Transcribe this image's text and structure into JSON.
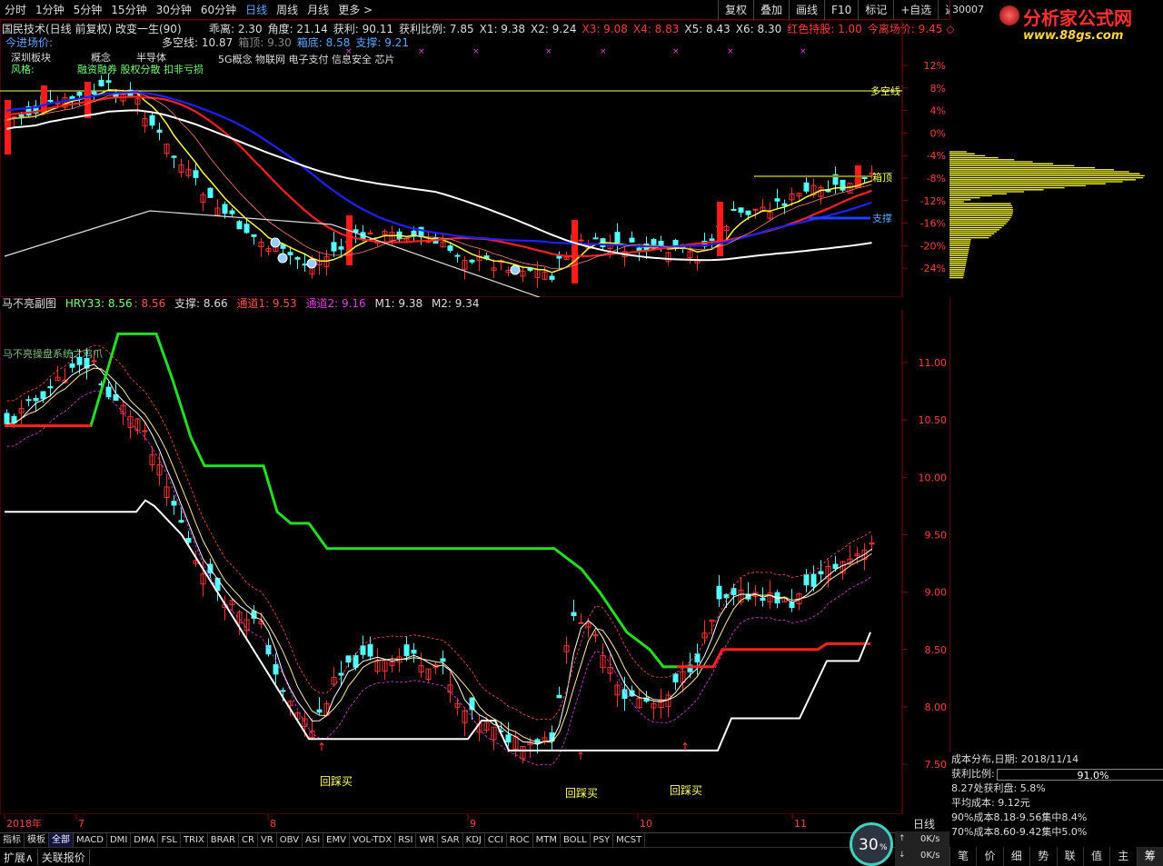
{
  "toolbar": {
    "periods": [
      "分时",
      "1分钟",
      "5分钟",
      "15分钟",
      "30分钟",
      "60分钟",
      "日线",
      "周线",
      "月线",
      "更多 >"
    ],
    "active": "日线",
    "right": [
      "复权",
      "叠加",
      "画线",
      "F10",
      "标记",
      "+自选",
      "返回"
    ]
  },
  "stock_code": "30007",
  "logo": {
    "title": "分析家公式网",
    "url": "www.88gs.com"
  },
  "main_panel": {
    "title": "国民技术(日线 前复权) 改变一生(90)",
    "line1": [
      {
        "t": "乖离: 2.30",
        "c": "#ddd"
      },
      {
        "t": "角度: 21.14",
        "c": "#ddd"
      },
      {
        "t": "获利: 90.11",
        "c": "#ddd"
      },
      {
        "t": "获利比例: 7.85",
        "c": "#ddd"
      },
      {
        "t": "X1: 9.38",
        "c": "#ddd"
      },
      {
        "t": "X2: 9.24",
        "c": "#ddd"
      },
      {
        "t": "X3: 9.08",
        "c": "#ff3a3a"
      },
      {
        "t": "X4: 8.83",
        "c": "#ff3a3a"
      },
      {
        "t": "X5: 8.43",
        "c": "#ddd"
      },
      {
        "t": "X6: 8.30",
        "c": "#ddd"
      },
      {
        "t": "红色持股: 1.00",
        "c": "#ff3a3a"
      },
      {
        "t": "今离场价: 9.45 ◇",
        "c": "#ff3a3a"
      }
    ],
    "line2_left": "今进场价:",
    "line2": [
      {
        "t": "多空线: 10.87",
        "c": "#ddd"
      },
      {
        "t": "箱顶: 9.30",
        "c": "#888"
      },
      {
        "t": "箱底: 8.58",
        "c": "#5ea8ff"
      },
      {
        "t": "支撑: 9.21",
        "c": "#5ea8ff"
      }
    ],
    "board": "深圳板块",
    "concept": "概念",
    "style": "风格:",
    "style_tags": "融资融券 股权分散 扣非亏损",
    "semi": "半导体",
    "concept_list": "5G概念 物联网 电子支付 信息安全 芯片",
    "duokong_label": "多空线",
    "box_top_label": "箱顶",
    "support_label": "支撑",
    "pct_axis": [
      "12%",
      "8%",
      "4%",
      "0%",
      "-4%",
      "-8%",
      "-12%",
      "-16%",
      "-20%",
      "-24%"
    ]
  },
  "sub_panel": {
    "title": "马不亮副图",
    "hry": "HRY33: 8.56",
    "hry2": ": 8.56",
    "support": "支撑: 8.66",
    "ch1": "通道1: 9.53",
    "ch2": "通道2: 9.16",
    "m1": "M1: 9.38",
    "m2": "M2: 9.34",
    "note": "马不亮操盘系统之鸡爪",
    "price_axis": [
      "11.00",
      "10.50",
      "10.00",
      "9.50",
      "9.00",
      "8.50",
      "8.00",
      "7.50"
    ],
    "buy_labels": [
      "回踩买",
      "回踩买",
      "回踩买"
    ]
  },
  "time_axis": {
    "labels": [
      "2018年",
      "7",
      "8",
      "9",
      "10",
      "11"
    ],
    "period": "日线"
  },
  "indicator_tabs": [
    "指标",
    "模板",
    "全部",
    "MACD",
    "DMI",
    "DMA",
    "FSL",
    "TRIX",
    "BRAR",
    "CR",
    "VR",
    "OBV",
    "ASI",
    "EMV",
    "VOL-TDX",
    "RSI",
    "WR",
    "SAR",
    "KDJ",
    "CCI",
    "ROC",
    "MTM",
    "BOLL",
    "PSY",
    "MCST"
  ],
  "indicator_selected": "全部",
  "footer": [
    "扩展∧",
    "关联报价"
  ],
  "cost": {
    "date": "成本分布,日期: 2018/11/14",
    "profit_label": "获利比例:",
    "profit_value": "91.0%",
    "profit_pct": 0.91,
    "line1": "8.27处获利盘: 5.8%",
    "line2": "平均成本: 9.12元",
    "line3": "90%成本8.18-9.56集中8.4%",
    "line4": "70%成本8.60-9.42集中5.0%"
  },
  "net": {
    "pct": "30",
    "up": "0K/s",
    "down": "0K/s"
  },
  "right_tabs": [
    "笔",
    "价",
    "细",
    "势",
    "联",
    "值",
    "主",
    "筹"
  ],
  "right_selected": "筹",
  "colors": {
    "up": "#ff3333",
    "down": "#54ffff",
    "bg": "#000000",
    "grid": "#8b0000",
    "accent": "#5ea8ff"
  }
}
